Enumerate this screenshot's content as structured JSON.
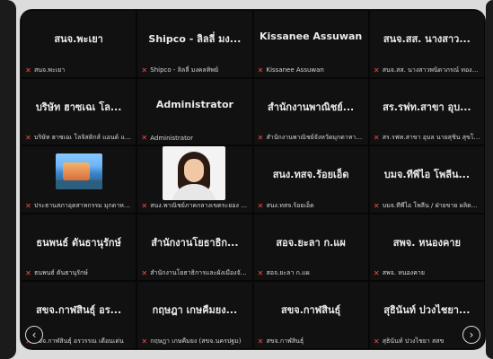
{
  "tiles": [
    {
      "display_name": "สนจ.พะเยา",
      "label": "สนจ.พะเยา"
    },
    {
      "display_name": "Shipco - ลิลลี่ มง...",
      "label": "Shipco - ลิลลี่ มงคลทิพย์"
    },
    {
      "display_name": "Kissanee Assuwan",
      "label": "Kissanee Assuwan"
    },
    {
      "display_name": "สนจ.สส. นางสาว...",
      "label": "สนจ.สส. นางสาวพนิดาภรณ์ ทองนวนดี"
    },
    {
      "display_name": "บริษัท ฮาซเฉเ โล...",
      "label": "บริษัท ฮาซเฉเ โลจิสติกส์ แอนด์ แมเนจเม้นท์ จำกัด"
    },
    {
      "display_name": "Administrator",
      "label": "Administrator"
    },
    {
      "display_name": "สำนักงานพาณิชย์...",
      "label": "สำนักงานพาณิชย์จังหวัดมุกดาหาร (2)"
    },
    {
      "display_name": "สร.รฟท.สาขา อุบ...",
      "label": "สร.รฟท.สาขา อุบล นายสุชิน สุขโฉม"
    },
    {
      "display_name": "",
      "label": "ประธานสภาอุตสาหกรรม มุกดาหาร ไทรทรัพย์"
    },
    {
      "display_name": "",
      "label": "สนง.พาณิชย์ภาคกลางเขตระยอง นางสาวศุภดี จันทมล"
    },
    {
      "display_name": "สนง.ทสจ.ร้อยเอ็ด",
      "label": "สนง.ทสจ.ร้อยเอ็ด"
    },
    {
      "display_name": "บมจ.ทีพีไอ โพลีน...",
      "label": "บมจ.ทีพีไอ โพลีน / ฝ่ายขาย ผลิตภัณฑ์"
    },
    {
      "display_name": "ธนพนธ์ ดันธานุรักษ์",
      "label": "ธนพนธ์ ดันธานุรักษ์"
    },
    {
      "display_name": "สำนักงานโยธาธิก...",
      "label": "สำนักงานโยธาธิการและผังเมืองจังหวัดศรีสะเกษ"
    },
    {
      "display_name": "สอจ.ยะลา ก.แผ",
      "label": "สอจ.ยะลา ก.แผ"
    },
    {
      "display_name": "สพจ. หนองคาย",
      "label": "สพจ. หนองคาย"
    },
    {
      "display_name": "สขจ.กาฬสินธุ์ อร...",
      "label": "สขจ.กาฬสินธุ์ อรวรรณ เดือนเด่น"
    },
    {
      "display_name": "กฤษฎา เกษคืมยง...",
      "label": "กฤษฎา เกษคืมยง (สขจ.นครปฐม)"
    },
    {
      "display_name": "สขจ.กาฬสินธุ์",
      "label": "สขจ.กาฬสินธุ์"
    },
    {
      "display_name": "สุธินันท์ ปวงไชยา...",
      "label": "สุธินันท์ ปวงไชยา สสข"
    }
  ],
  "nav": {
    "prev": "‹",
    "next": "›"
  },
  "icons": {
    "mic_off": "mic-off-icon"
  }
}
